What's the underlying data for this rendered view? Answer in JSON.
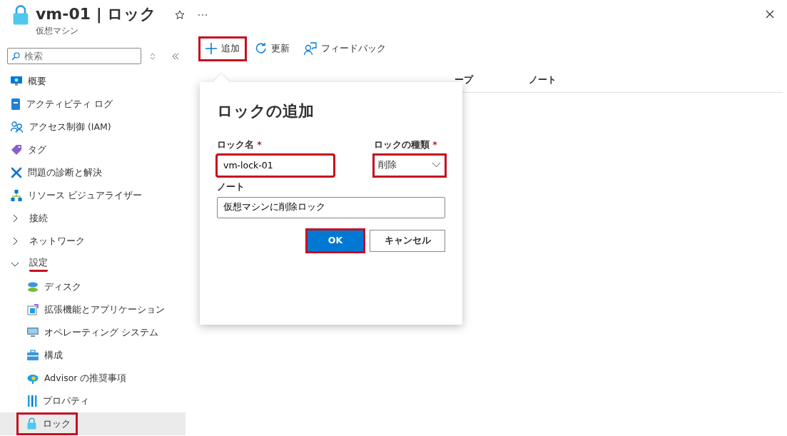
{
  "header": {
    "title": "vm-01 | ロック",
    "subtitle": "仮想マシン",
    "favorite": false
  },
  "sidebar": {
    "search": {
      "placeholder": "検索"
    },
    "items": [
      {
        "label": "概要",
        "kind": "item",
        "selected": false,
        "highlighted": false
      },
      {
        "label": "アクティビティ ログ",
        "kind": "item",
        "selected": false,
        "highlighted": false
      },
      {
        "label": "アクセス制御 (IAM)",
        "kind": "item",
        "selected": false,
        "highlighted": false
      },
      {
        "label": "タグ",
        "kind": "item",
        "selected": false,
        "highlighted": false
      },
      {
        "label": "問題の診断と解決",
        "kind": "item",
        "selected": false,
        "highlighted": false
      },
      {
        "label": "リソース ビジュアライザー",
        "kind": "item",
        "selected": false,
        "highlighted": false
      },
      {
        "label": "接続",
        "kind": "group",
        "expanded": false,
        "selected": false,
        "highlighted": false
      },
      {
        "label": "ネットワーク",
        "kind": "group",
        "expanded": false,
        "selected": false,
        "highlighted": false
      },
      {
        "label": "設定",
        "kind": "group",
        "expanded": true,
        "selected": false,
        "highlighted": true,
        "children": [
          {
            "label": "ディスク",
            "selected": false,
            "highlighted": false
          },
          {
            "label": "拡張機能とアプリケーション",
            "selected": false,
            "highlighted": false
          },
          {
            "label": "オペレーティング システム",
            "selected": false,
            "highlighted": false
          },
          {
            "label": "構成",
            "selected": false,
            "highlighted": false
          },
          {
            "label": "Advisor の推奨事項",
            "selected": false,
            "highlighted": false
          },
          {
            "label": "プロパティ",
            "selected": false,
            "highlighted": false
          },
          {
            "label": "ロック",
            "selected": true,
            "highlighted": true
          }
        ]
      }
    ]
  },
  "toolbar": [
    {
      "label": "追加",
      "highlighted": true
    },
    {
      "label": "更新",
      "highlighted": false
    },
    {
      "label": "フィードバック",
      "highlighted": false
    }
  ],
  "table": {
    "columns": [
      "ープ",
      "ノート"
    ]
  },
  "dialog": {
    "title": "ロックの追加",
    "lock_name": {
      "label": "ロック名",
      "required_mark": "*",
      "value": "vm-lock-01",
      "highlighted": true
    },
    "lock_type": {
      "label": "ロックの種類",
      "required_mark": "*",
      "value": "削除",
      "highlighted": true
    },
    "note": {
      "label": "ノート",
      "value": "仮想マシンに削除ロック"
    },
    "buttons": [
      {
        "label": "OK",
        "kind": "primary",
        "highlighted": true
      },
      {
        "label": "キャンセル",
        "kind": "secondary",
        "highlighted": false
      }
    ]
  }
}
